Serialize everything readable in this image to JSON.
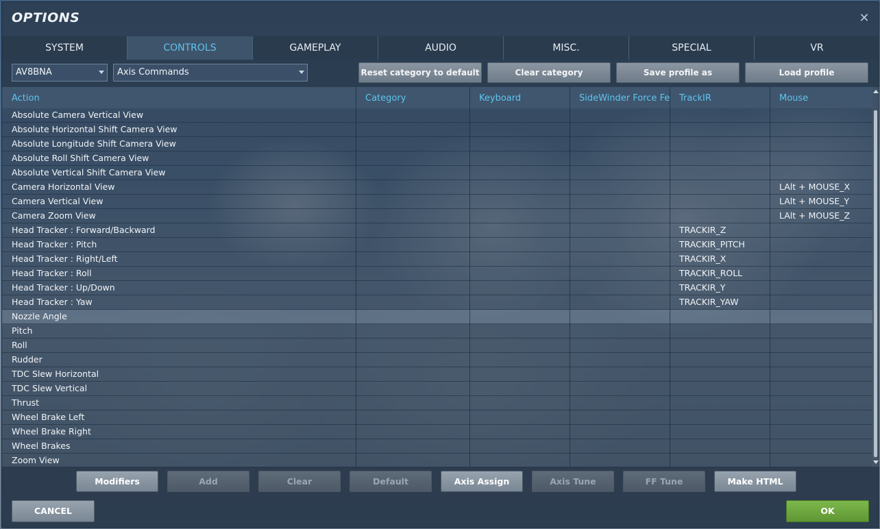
{
  "window": {
    "title": "OPTIONS",
    "close_icon": "close-icon"
  },
  "tabs": [
    {
      "label": "SYSTEM",
      "active": false
    },
    {
      "label": "CONTROLS",
      "active": true
    },
    {
      "label": "GAMEPLAY",
      "active": false
    },
    {
      "label": "AUDIO",
      "active": false
    },
    {
      "label": "MISC.",
      "active": false
    },
    {
      "label": "SPECIAL",
      "active": false
    },
    {
      "label": "VR",
      "active": false
    }
  ],
  "toolbar": {
    "aircraft_select": "AV8BNA",
    "category_select": "Axis Commands",
    "reset_label": "Reset category to default",
    "clear_label": "Clear category",
    "save_label": "Save profile as",
    "load_label": "Load profile"
  },
  "table": {
    "headers": [
      "Action",
      "Category",
      "Keyboard",
      "SideWinder Force Feec",
      "TrackIR",
      "Mouse"
    ],
    "rows": [
      {
        "action": "Absolute Camera Vertical View",
        "trackir": "",
        "mouse": ""
      },
      {
        "action": "Absolute Horizontal Shift Camera View",
        "trackir": "",
        "mouse": ""
      },
      {
        "action": "Absolute Longitude Shift Camera View",
        "trackir": "",
        "mouse": ""
      },
      {
        "action": "Absolute Roll Shift Camera View",
        "trackir": "",
        "mouse": ""
      },
      {
        "action": "Absolute Vertical Shift Camera View",
        "trackir": "",
        "mouse": ""
      },
      {
        "action": "Camera Horizontal View",
        "trackir": "",
        "mouse": "LAlt + MOUSE_X"
      },
      {
        "action": "Camera Vertical View",
        "trackir": "",
        "mouse": "LAlt + MOUSE_Y"
      },
      {
        "action": "Camera Zoom View",
        "trackir": "",
        "mouse": "LAlt + MOUSE_Z"
      },
      {
        "action": "Head Tracker : Forward/Backward",
        "trackir": "TRACKIR_Z",
        "mouse": ""
      },
      {
        "action": "Head Tracker : Pitch",
        "trackir": "TRACKIR_PITCH",
        "mouse": ""
      },
      {
        "action": "Head Tracker : Right/Left",
        "trackir": "TRACKIR_X",
        "mouse": ""
      },
      {
        "action": "Head Tracker : Roll",
        "trackir": "TRACKIR_ROLL",
        "mouse": ""
      },
      {
        "action": "Head Tracker : Up/Down",
        "trackir": "TRACKIR_Y",
        "mouse": ""
      },
      {
        "action": "Head Tracker : Yaw",
        "trackir": "TRACKIR_YAW",
        "mouse": ""
      },
      {
        "action": "Nozzle Angle",
        "trackir": "",
        "mouse": ""
      },
      {
        "action": "Pitch",
        "trackir": "",
        "mouse": ""
      },
      {
        "action": "Roll",
        "trackir": "",
        "mouse": ""
      },
      {
        "action": "Rudder",
        "trackir": "",
        "mouse": ""
      },
      {
        "action": "TDC Slew Horizontal",
        "trackir": "",
        "mouse": ""
      },
      {
        "action": "TDC Slew Vertical",
        "trackir": "",
        "mouse": ""
      },
      {
        "action": "Thrust",
        "trackir": "",
        "mouse": ""
      },
      {
        "action": "Wheel Brake Left",
        "trackir": "",
        "mouse": ""
      },
      {
        "action": "Wheel Brake Right",
        "trackir": "",
        "mouse": ""
      },
      {
        "action": "Wheel Brakes",
        "trackir": "",
        "mouse": ""
      },
      {
        "action": "Zoom View",
        "trackir": "",
        "mouse": ""
      }
    ],
    "selected_row_action": "Nozzle Angle"
  },
  "bottom_buttons": [
    {
      "label": "Modifiers",
      "enabled": true
    },
    {
      "label": "Add",
      "enabled": false
    },
    {
      "label": "Clear",
      "enabled": false
    },
    {
      "label": "Default",
      "enabled": false
    },
    {
      "label": "Axis Assign",
      "enabled": true
    },
    {
      "label": "Axis Tune",
      "enabled": false
    },
    {
      "label": "FF Tune",
      "enabled": false
    },
    {
      "label": "Make HTML",
      "enabled": true
    }
  ],
  "footer": {
    "cancel_label": "CANCEL",
    "ok_label": "OK"
  },
  "colors": {
    "accent": "#5fc4ee",
    "ok_green": "#6fa840"
  }
}
